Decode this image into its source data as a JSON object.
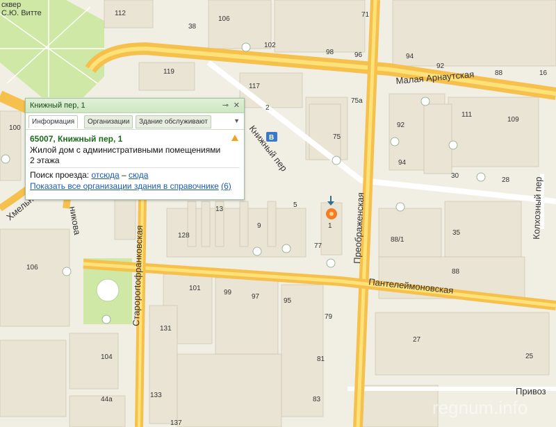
{
  "popup": {
    "title": "Книжный пер, 1",
    "pin_icon": "pin-icon",
    "close_icon": "close-icon",
    "tabs": [
      "Информация",
      "Организации",
      "Здание обслуживают"
    ],
    "active_tab": "Информация",
    "address": "65007, Книжный пер, 1",
    "description": "Жилой дом с административными помещениями",
    "floors": "2 этажа",
    "route_label": "Поиск проезда:",
    "route_from": "отсюда",
    "route_dash": "–",
    "route_to": "сюда",
    "orgs_link": "Показать все организации здания в справочнике",
    "orgs_count": "(6)"
  },
  "map": {
    "colors": {
      "major_road": "#f6c04c",
      "major_road_inner": "#fde27a",
      "park": "#cfe8a6",
      "water_school": "#c9d3ef",
      "building": "#eae4d4",
      "selected": "#f4a6a0"
    },
    "streets": {
      "malaya_arnautskaya": "Малая Арнаутская",
      "knizhny": "Книжный пер",
      "preobrazhenskaya": "Преображенская",
      "panteleimonovskaya": "Пантелеймоновская",
      "staroportofrankovskaya": "Староportофранковская",
      "kolkhozny": "Колхозный пер",
      "privoznaya": "Привоз",
      "khmelnitskogo": "Хмельни",
      "nikova": "никова"
    },
    "park_label": "сквер",
    "park_label2": "С.Ю. Витте",
    "houses": [
      "112",
      "106",
      "71",
      "38",
      "102",
      "98",
      "96",
      "94",
      "92",
      "88",
      "16",
      "119",
      "117",
      "2",
      "75а",
      "75",
      "111",
      "109",
      "92",
      "94",
      "30",
      "28",
      "100",
      "13",
      "5",
      "9",
      "1",
      "77",
      "128",
      "35",
      "88/1",
      "106",
      "88",
      "101",
      "99",
      "97",
      "95",
      "79",
      "27",
      "131",
      "104",
      "81",
      "25",
      "133",
      "44а",
      "83",
      "137"
    ],
    "watermark": "regnum.info"
  }
}
